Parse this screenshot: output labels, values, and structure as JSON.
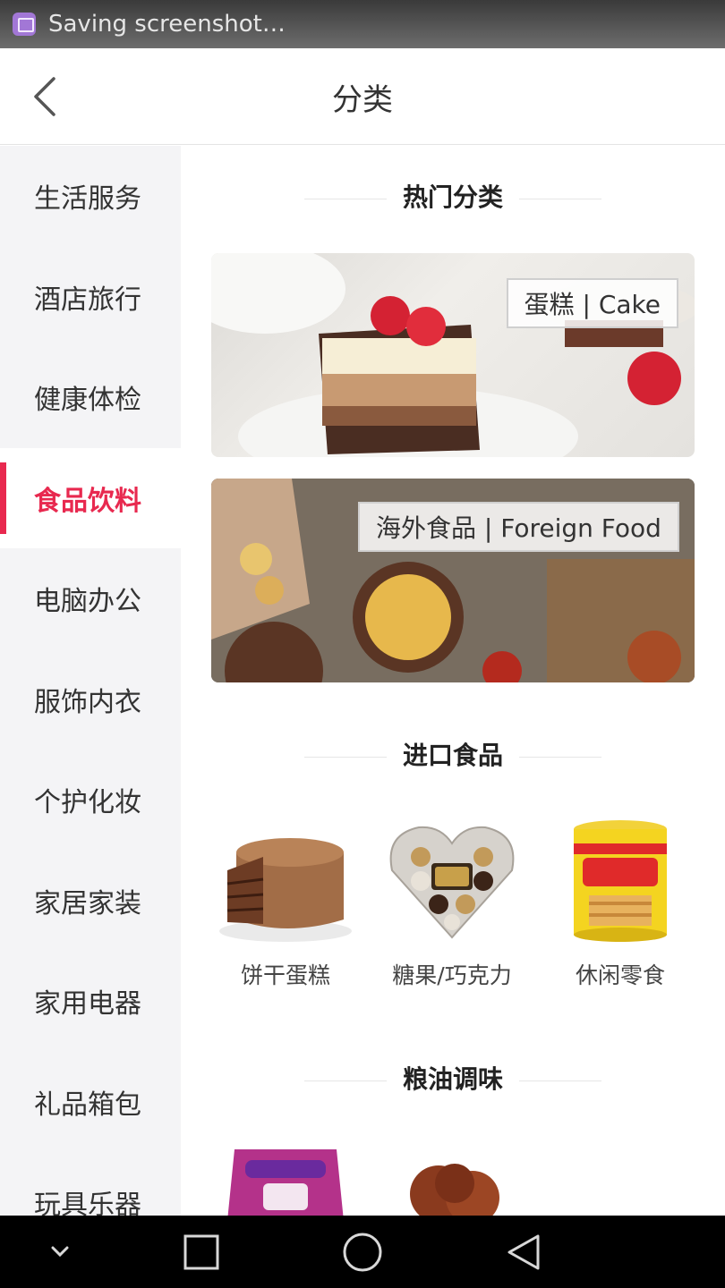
{
  "status_bar": {
    "notification_text": "Saving screenshot…"
  },
  "header": {
    "title": "分类"
  },
  "sidebar": {
    "items": [
      {
        "label": "生活服务"
      },
      {
        "label": "酒店旅行"
      },
      {
        "label": "健康体检"
      },
      {
        "label": "食品饮料",
        "active": true
      },
      {
        "label": "电脑办公"
      },
      {
        "label": "服饰内衣"
      },
      {
        "label": "个护化妆"
      },
      {
        "label": "家居家装"
      },
      {
        "label": "家用电器"
      },
      {
        "label": "礼品箱包"
      },
      {
        "label": "玩具乐器"
      }
    ]
  },
  "content": {
    "hot_section_title": "热门分类",
    "banners": [
      {
        "label": "蛋糕 | Cake"
      },
      {
        "label": "海外食品 | Foreign Food"
      }
    ],
    "import_section_title": "进口食品",
    "import_items": [
      {
        "label": "饼干蛋糕"
      },
      {
        "label": "糖果/巧克力"
      },
      {
        "label": "休闲零食"
      }
    ],
    "grain_section_title": "粮油调味"
  },
  "colors": {
    "accent": "#e8294f",
    "sidebar_bg": "#f4f4f6"
  }
}
